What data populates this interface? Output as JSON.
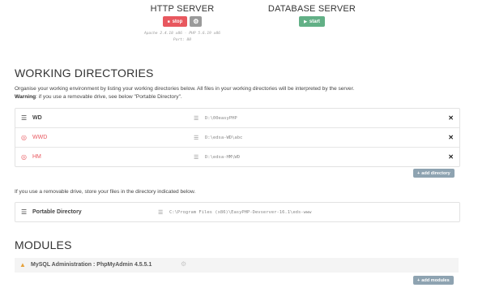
{
  "http_server": {
    "title": "HTTP SERVER",
    "stop_label": "stop",
    "info_line1": "Apache 2.4.18 x86 - PHP 5.6.19 x86",
    "info_line2": "Port: 80"
  },
  "database_server": {
    "title": "DATABASE SERVER",
    "start_label": "start"
  },
  "working_directories": {
    "title": "WORKING DIRECTORIES",
    "intro": "Organise your working environment by listing your working directories below. All files in your working directories will be interpreted by the server.",
    "warning_label": "Warning",
    "warning_text": ": if you use a removable drive, see below \"Portable Directory\".",
    "items": [
      {
        "name": "WD",
        "path": "D:\\00easyPHP",
        "status": "ok"
      },
      {
        "name": "WWD",
        "path": "D:\\edsa-WD\\abc",
        "status": "error"
      },
      {
        "name": "HM",
        "path": "D:\\edsa-HM\\WD",
        "status": "error"
      }
    ],
    "add_label": "add directory",
    "removable_note": "If you use a removable drive, store your files in the directory indicated below.",
    "portable": {
      "name": "Portable Directory",
      "path": "C:\\Program Files (x86)\\EasyPHP-Devserver-16.1\\eds-www"
    }
  },
  "modules": {
    "title": "MODULES",
    "items": [
      {
        "name": "MySQL Administration : PhpMyAdmin 4.5.5.1"
      }
    ],
    "add_label": "add modules"
  },
  "colors": {
    "stop": "#e8585f",
    "start": "#62b086",
    "gear": "#9a9a9a",
    "add": "#8ea3b1",
    "error": "#e8585f"
  }
}
